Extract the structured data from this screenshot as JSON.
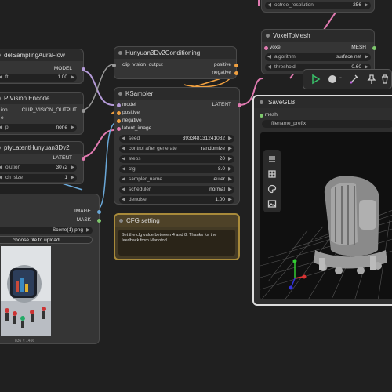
{
  "nodes": {
    "model_sampling": {
      "title": "delSamplingAuraFlow",
      "output": "MODEL",
      "widget_label": "ft",
      "widget_value": "1.00"
    },
    "clip_vision_encode": {
      "title": "P Vision Encode",
      "input1": "ion",
      "output": "CLIP_VISION_OUTPUT",
      "input2": "e",
      "widget_label": "p",
      "widget_value": "none"
    },
    "empty_latent": {
      "title": "ptyLatentHunyuan3Dv2",
      "output": "LATENT",
      "widget1_label": "olution",
      "widget1_value": "3072",
      "widget2_label": "ch_size",
      "widget2_value": "1"
    },
    "load_image": {
      "title": "",
      "output1": "IMAGE",
      "output2": "MASK",
      "file_value": "Scene(1).png",
      "upload_label": "choose file to upload",
      "caption": "836 × 1456"
    },
    "conditioning": {
      "title": "Hunyuan3Dv2Conditioning",
      "input": "clip_vision_output",
      "output1": "positive",
      "output2": "negative"
    },
    "ksampler": {
      "title": "KSampler",
      "inputs": [
        "model",
        "positive",
        "negative",
        "latent_image"
      ],
      "output": "LATENT",
      "widgets": [
        {
          "label": "seed",
          "value": "393348131241082"
        },
        {
          "label": "control after generate",
          "value": "randomize"
        },
        {
          "label": "steps",
          "value": "20"
        },
        {
          "label": "cfg",
          "value": "8.0"
        },
        {
          "label": "sampler_name",
          "value": "euler"
        },
        {
          "label": "scheduler",
          "value": "normal"
        },
        {
          "label": "denoise",
          "value": "1.00"
        }
      ]
    },
    "cfg_note": {
      "title": "CFG setting",
      "text": "Set the cfg value between 4 and 8. Thanks for the feedback from Manofod."
    },
    "octree": {
      "label": "octree_resolution",
      "value": "256"
    },
    "voxel_to_mesh": {
      "title": "VoxelToMesh",
      "input": "voxel",
      "output": "MESH",
      "widget1_label": "algorithm",
      "widget1_value": "surface net",
      "widget2_label": "threshold",
      "widget2_value": "0.60"
    },
    "save_glb": {
      "title": "SaveGLB",
      "input": "mesh",
      "widget_label": "filename_prefix"
    }
  },
  "colors": {
    "canvas": "#202020",
    "node_bg": "#353535",
    "note_bg": "#433a25",
    "note_border": "#a88a3a",
    "viewer_bg": "#101010"
  },
  "toolbar_icons": [
    "play-icon",
    "color-circle-icon",
    "bypass-pen-icon",
    "pin-icon",
    "trash-icon"
  ],
  "viewer_side_icons": [
    "menu-icon",
    "grid-icon",
    "palette-icon",
    "image-icon"
  ]
}
